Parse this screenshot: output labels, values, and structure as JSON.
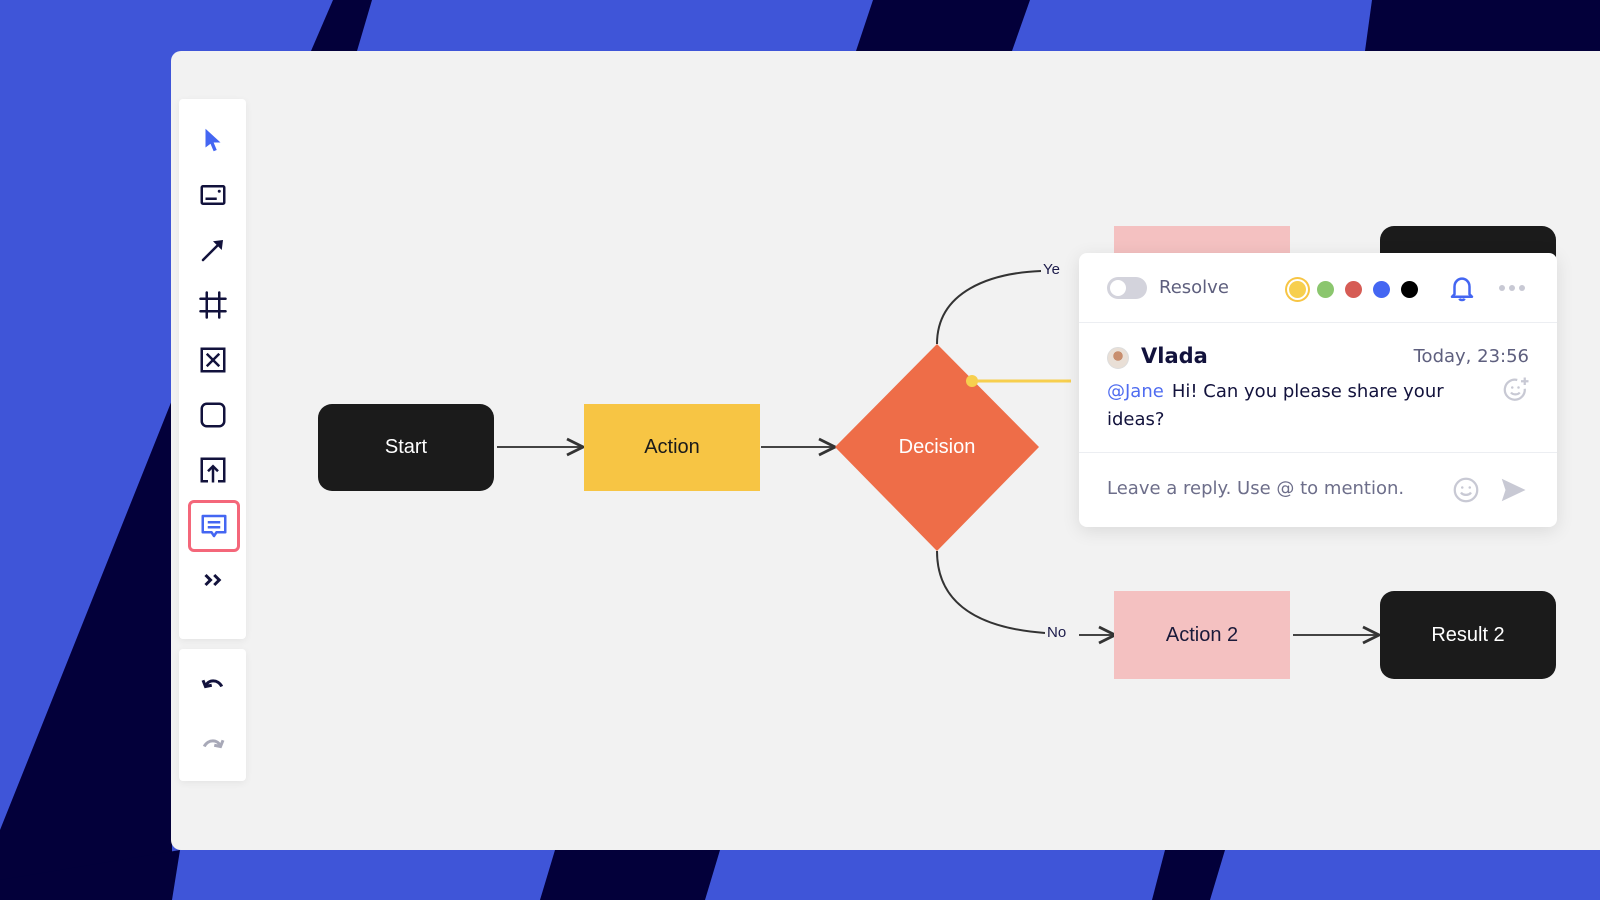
{
  "colors": {
    "background_blue": "#3f55d8",
    "background_navy": "#03003a",
    "canvas": "#f2f2f2",
    "accent": "#4f6cf0",
    "active_tool_border": "#f4677a"
  },
  "toolbar": {
    "tools": [
      {
        "name": "select",
        "icon": "cursor-icon",
        "active": false
      },
      {
        "name": "text",
        "icon": "text-box-icon",
        "active": false
      },
      {
        "name": "arrow",
        "icon": "arrow-icon",
        "active": false
      },
      {
        "name": "frame",
        "icon": "frame-icon",
        "active": false
      },
      {
        "name": "placeholder",
        "icon": "image-placeholder-icon",
        "active": false
      },
      {
        "name": "shape",
        "icon": "rounded-square-icon",
        "active": false
      },
      {
        "name": "upload",
        "icon": "upload-icon",
        "active": false
      },
      {
        "name": "comment",
        "icon": "comment-icon",
        "active": true
      },
      {
        "name": "more",
        "icon": "double-chevron-right-icon",
        "active": false
      }
    ],
    "history": [
      {
        "name": "undo",
        "icon": "undo-icon",
        "enabled": true
      },
      {
        "name": "redo",
        "icon": "redo-icon",
        "enabled": false
      }
    ]
  },
  "flowchart": {
    "nodes": [
      {
        "id": "start",
        "label": "Start",
        "shape": "rounded-rect",
        "fill": "#1b1b1b"
      },
      {
        "id": "action",
        "label": "Action",
        "shape": "rect",
        "fill": "#f7c544"
      },
      {
        "id": "decision",
        "label": "Decision",
        "shape": "diamond",
        "fill": "#ee6d48"
      },
      {
        "id": "action1",
        "label": "",
        "shape": "rect",
        "fill": "#f4c1c1"
      },
      {
        "id": "result1",
        "label": "",
        "shape": "rounded-rect",
        "fill": "#1b1b1b"
      },
      {
        "id": "action2",
        "label": "Action 2",
        "shape": "rect",
        "fill": "#f4c1c1"
      },
      {
        "id": "result2",
        "label": "Result 2",
        "shape": "rounded-rect",
        "fill": "#1b1b1b"
      }
    ],
    "edges": [
      {
        "from": "start",
        "to": "action",
        "label": ""
      },
      {
        "from": "action",
        "to": "decision",
        "label": ""
      },
      {
        "from": "decision",
        "to": "action1",
        "label": "Yes"
      },
      {
        "from": "decision",
        "to": "action2",
        "label": "No"
      },
      {
        "from": "action2",
        "to": "result2",
        "label": ""
      }
    ],
    "yes_label_visible": "Ye",
    "no_label": "No"
  },
  "comment": {
    "resolve_label": "Resolve",
    "resolved": false,
    "colors": [
      {
        "name": "yellow",
        "hex": "#f7cf4e",
        "selected": true
      },
      {
        "name": "green",
        "hex": "#8bc66e",
        "selected": false
      },
      {
        "name": "red",
        "hex": "#d65c55",
        "selected": false
      },
      {
        "name": "blue",
        "hex": "#4466f2",
        "selected": false
      },
      {
        "name": "black",
        "hex": "#000000",
        "selected": false
      }
    ],
    "author": "Vlada",
    "timestamp": "Today, 23:56",
    "mention": "@Jane",
    "message": "Hi! Can you please share your ideas?",
    "reply_placeholder": "Leave a reply. Use @ to mention."
  }
}
